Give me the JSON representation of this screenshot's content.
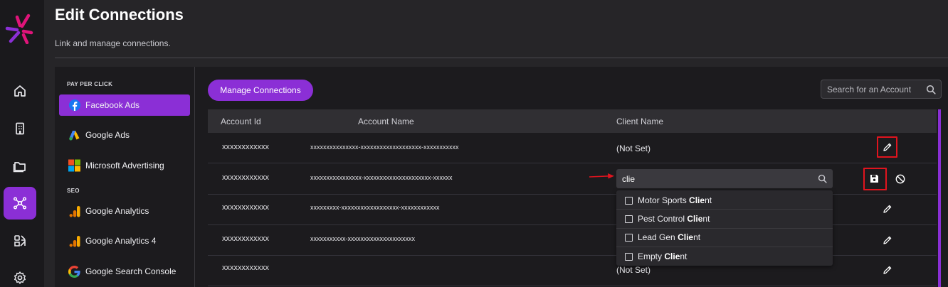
{
  "header": {
    "title": "Edit Connections",
    "subtitle": "Link and manage connections."
  },
  "rail": {
    "items": [
      {
        "name": "home-icon",
        "active": false
      },
      {
        "name": "building-icon",
        "active": false
      },
      {
        "name": "folder-icon",
        "active": false
      },
      {
        "name": "connections-icon",
        "active": true
      },
      {
        "name": "reports-icon",
        "active": false
      },
      {
        "name": "settings-gear-icon",
        "active": false
      }
    ]
  },
  "sidebar": {
    "sections": [
      {
        "label": "PAY PER CLICK",
        "items": [
          {
            "label": "Facebook Ads",
            "icon": "facebook-icon",
            "active": true
          },
          {
            "label": "Google Ads",
            "icon": "google-ads-icon",
            "active": false
          },
          {
            "label": "Microsoft Advertising",
            "icon": "microsoft-icon",
            "active": false
          }
        ]
      },
      {
        "label": "SEO",
        "items": [
          {
            "label": "Google Analytics",
            "icon": "google-analytics-icon",
            "active": false
          },
          {
            "label": "Google Analytics 4",
            "icon": "google-analytics-icon",
            "active": false
          },
          {
            "label": "Google Search Console",
            "icon": "google-icon",
            "active": false
          }
        ]
      }
    ]
  },
  "main": {
    "manage_button": "Manage Connections",
    "search_placeholder": "Search for an Account",
    "columns": [
      "Account Id",
      "Account Name",
      "Client Name"
    ],
    "rows": [
      {
        "account_id": "xxxxxxxxxxxx",
        "account_name": "xxxxxxxxxxxxxxx-xxxxxxxxxxxxxxxxxxx-xxxxxxxxxxx",
        "client": "(Not Set)",
        "editing": false
      },
      {
        "account_id": "xxxxxxxxxxxx",
        "account_name": "xxxxxxxxxxxxxxxx-xxxxxxxxxxxxxxxxxxxxx-xxxxxx",
        "client": "",
        "editing": true
      },
      {
        "account_id": "xxxxxxxxxxxx",
        "account_name": "xxxxxxxxx-xxxxxxxxxxxxxxxxxx-xxxxxxxxxxxx",
        "client": "",
        "editing": false
      },
      {
        "account_id": "xxxxxxxxxxxx",
        "account_name": "xxxxxxxxxxx-xxxxxxxxxxxxxxxxxxxxx",
        "client": "",
        "editing": false
      },
      {
        "account_id": "xxxxxxxxxxxx",
        "account_name": "",
        "client": "(Not Set)",
        "editing": false
      }
    ],
    "combo_value": "clie",
    "dropdown_options": [
      {
        "prefix": "Motor Sports ",
        "match": "Clie",
        "suffix": "nt"
      },
      {
        "prefix": "Pest Control ",
        "match": "Clie",
        "suffix": "nt"
      },
      {
        "prefix": "Lead Gen ",
        "match": "Clie",
        "suffix": "nt"
      },
      {
        "prefix": "Empty ",
        "match": "Clie",
        "suffix": "nt"
      }
    ]
  },
  "colors": {
    "accent": "#8b2fd6",
    "highlight": "#e0141e",
    "background": "#262528",
    "panel": "#1c1b1e"
  }
}
